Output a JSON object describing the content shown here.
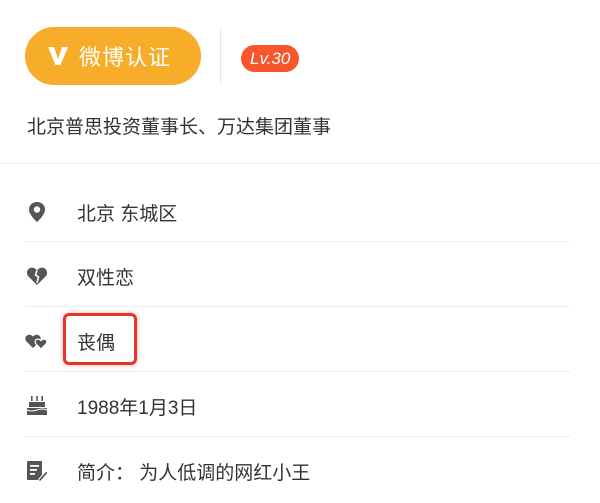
{
  "verify": {
    "label": "微博认证",
    "icon": "v-icon"
  },
  "level": {
    "text": "Lv.30"
  },
  "description": "北京普思投资董事长、万达集团董事",
  "rows": [
    {
      "icon": "location-icon",
      "text": "北京 东城区"
    },
    {
      "icon": "orientation-heart-icon",
      "text": "双性恋"
    },
    {
      "icon": "relationship-heart-icon",
      "text": "丧偶"
    },
    {
      "icon": "birthday-cake-icon",
      "text": "1988年1月3日"
    },
    {
      "icon": "intro-edit-icon",
      "text": "简介：  为人低调的网红小王"
    }
  ],
  "colors": {
    "accent": "#f7ad2a",
    "level_badge": "#f7552a",
    "highlight": "#e8352a",
    "icon": "#555555"
  }
}
